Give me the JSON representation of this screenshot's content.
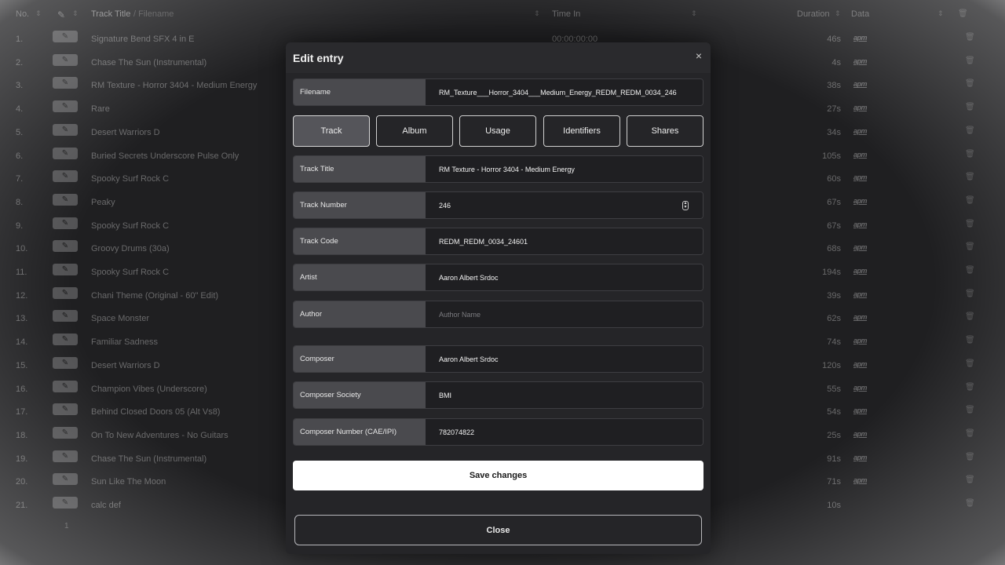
{
  "table": {
    "headers": {
      "no": "No.",
      "track_title": "Track Title",
      "filename": "/ Filename",
      "time_in": "Time In",
      "duration": "Duration",
      "data": "Data"
    },
    "edit_glyph": "✎",
    "delete_glyph": "🗑",
    "sort_glyph": "⇕",
    "rows": [
      {
        "no": "1.",
        "title": "Signature Bend SFX 4 in E",
        "time_in": "00:00:00:00",
        "duration": "46s",
        "data": "apm"
      },
      {
        "no": "2.",
        "title": "Chase The Sun (Instrumental)",
        "time_in": "",
        "duration": "4s",
        "data": "apm"
      },
      {
        "no": "3.",
        "title": "RM Texture - Horror 3404 - Medium Energy",
        "time_in": "",
        "duration": "38s",
        "data": "apm"
      },
      {
        "no": "4.",
        "title": "Rare",
        "time_in": "",
        "duration": "27s",
        "data": "apm"
      },
      {
        "no": "5.",
        "title": "Desert Warriors D",
        "time_in": "",
        "duration": "34s",
        "data": "apm"
      },
      {
        "no": "6.",
        "title": "Buried Secrets Underscore Pulse Only",
        "time_in": "",
        "duration": "105s",
        "data": "apm"
      },
      {
        "no": "7.",
        "title": "Spooky Surf Rock C",
        "time_in": "",
        "duration": "60s",
        "data": "apm"
      },
      {
        "no": "8.",
        "title": "Peaky",
        "time_in": "",
        "duration": "67s",
        "data": "apm"
      },
      {
        "no": "9.",
        "title": "Spooky Surf Rock C",
        "time_in": "",
        "duration": "67s",
        "data": "apm"
      },
      {
        "no": "10.",
        "title": "Groovy Drums (30a)",
        "time_in": "",
        "duration": "68s",
        "data": "apm"
      },
      {
        "no": "11.",
        "title": "Spooky Surf Rock C",
        "time_in": "",
        "duration": "194s",
        "data": "apm"
      },
      {
        "no": "12.",
        "title": "Chani Theme (Original - 60\" Edit)",
        "time_in": "",
        "duration": "39s",
        "data": "apm"
      },
      {
        "no": "13.",
        "title": "Space Monster",
        "time_in": "",
        "duration": "62s",
        "data": "apm"
      },
      {
        "no": "14.",
        "title": "Familiar Sadness",
        "time_in": "",
        "duration": "74s",
        "data": "apm"
      },
      {
        "no": "15.",
        "title": "Desert Warriors D",
        "time_in": "",
        "duration": "120s",
        "data": "apm"
      },
      {
        "no": "16.",
        "title": "Champion Vibes (Underscore)",
        "time_in": "",
        "duration": "55s",
        "data": "apm"
      },
      {
        "no": "17.",
        "title": "Behind Closed Doors 05 (Alt Vs8)",
        "time_in": "",
        "duration": "54s",
        "data": "apm"
      },
      {
        "no": "18.",
        "title": "On To New Adventures - No Guitars",
        "time_in": "",
        "duration": "25s",
        "data": "apm"
      },
      {
        "no": "19.",
        "title": "Chase The Sun (Instrumental)",
        "time_in": "",
        "duration": "91s",
        "data": "apm"
      },
      {
        "no": "20.",
        "title": "Sun Like The Moon",
        "time_in": "",
        "duration": "71s",
        "data": "apm"
      },
      {
        "no": "21.",
        "title": "calc def",
        "time_in": "",
        "duration": "10s",
        "data": ""
      }
    ],
    "pager": "1"
  },
  "modal": {
    "title": "Edit entry",
    "close_x": "×",
    "filename": {
      "label": "Filename",
      "value": "RM_Texture___Horror_3404___Medium_Energy_REDM_REDM_0034_246"
    },
    "tabs": [
      "Track",
      "Album",
      "Usage",
      "Identifiers",
      "Shares"
    ],
    "active_tab": "Track",
    "fields": {
      "track_title": {
        "label": "Track Title",
        "value": "RM Texture - Horror 3404 - Medium Energy"
      },
      "track_number": {
        "label": "Track Number",
        "value": "246"
      },
      "track_code": {
        "label": "Track Code",
        "value": "REDM_REDM_0034_24601"
      },
      "artist": {
        "label": "Artist",
        "value": "Aaron Albert Srdoc"
      },
      "author": {
        "label": "Author",
        "value": "",
        "placeholder": "Author Name"
      },
      "composer": {
        "label": "Composer",
        "value": "Aaron Albert Srdoc"
      },
      "composer_society": {
        "label": "Composer Society",
        "value": "BMI"
      },
      "composer_number": {
        "label": "Composer Number (CAE/IPI)",
        "value": "782074822"
      }
    },
    "save_label": "Save changes",
    "close_label": "Close"
  }
}
